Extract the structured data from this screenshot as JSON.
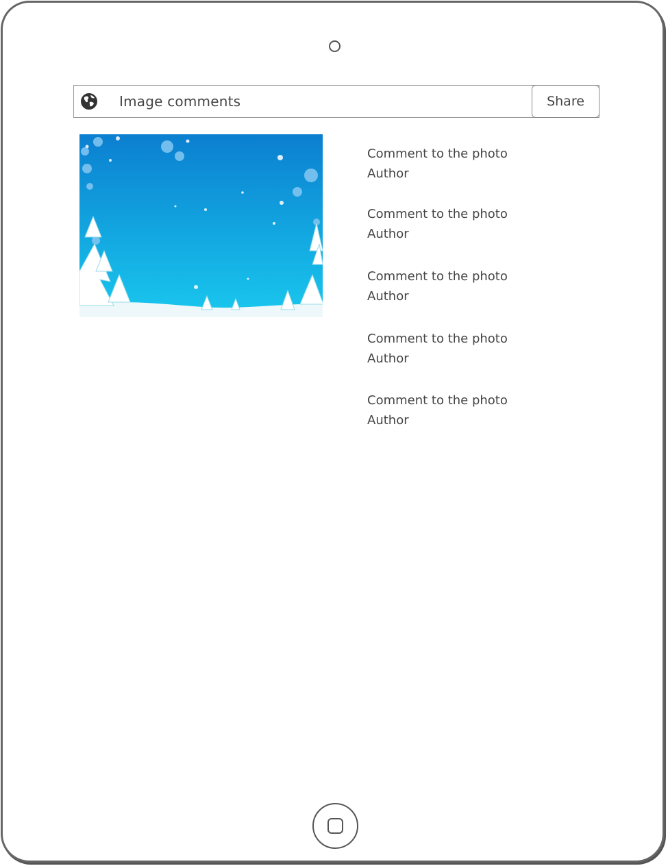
{
  "header": {
    "title": "Image comments",
    "share_label": "Share",
    "icon": "globe-icon"
  },
  "photo": {
    "description_icon": "winter-snow-scene-image"
  },
  "comments": [
    {
      "text": "Comment to the photo",
      "author": "Author"
    },
    {
      "text": "Comment to the photo",
      "author": "Author"
    },
    {
      "text": "Comment to the photo",
      "author": "Author"
    },
    {
      "text": "Comment to the photo",
      "author": "Author"
    },
    {
      "text": "Comment to the photo",
      "author": "Author"
    }
  ],
  "colors": {
    "sky_top": "#0b7fd0",
    "sky_bottom": "#19c8ee",
    "snow": "#eef8fb",
    "outline": "#555555"
  }
}
